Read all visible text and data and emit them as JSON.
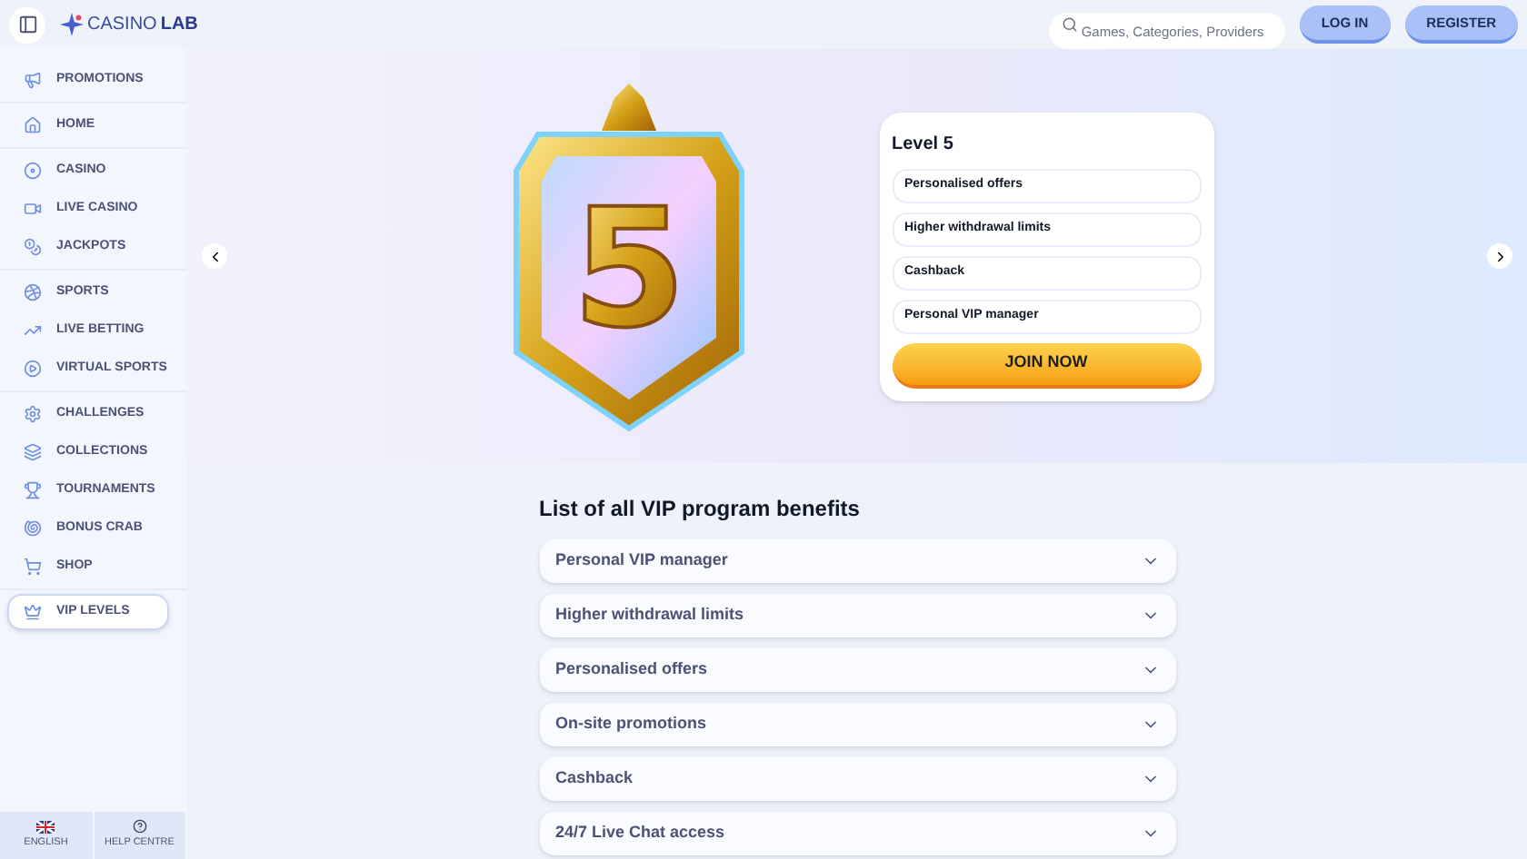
{
  "header": {
    "brand": {
      "light": "CASINO",
      "bold": "LAB"
    },
    "search": {
      "placeholder": "Games, Categories, Providers"
    },
    "buttons": [
      "LOG IN",
      "REGISTER"
    ]
  },
  "sidebar": {
    "groups": [
      [
        {
          "label": "PROMOTIONS",
          "selected": false
        }
      ],
      [
        {
          "label": "HOME",
          "selected": false
        }
      ],
      [
        {
          "label": "CASINO",
          "selected": false
        },
        {
          "label": "LIVE CASINO",
          "selected": false
        },
        {
          "label": "JACKPOTS",
          "selected": false
        }
      ],
      [
        {
          "label": "SPORTS",
          "selected": false
        },
        {
          "label": "LIVE BETTING",
          "selected": false
        },
        {
          "label": "VIRTUAL SPORTS",
          "selected": false
        }
      ],
      [
        {
          "label": "CHALLENGES",
          "selected": false
        },
        {
          "label": "COLLECTIONS",
          "selected": false
        },
        {
          "label": "TOURNAMENTS",
          "selected": false
        },
        {
          "label": "BONUS CRAB",
          "selected": false
        },
        {
          "label": "SHOP",
          "selected": false
        }
      ],
      [
        {
          "label": "VIP LEVELS",
          "selected": true
        }
      ]
    ],
    "footer": [
      "ENGLISH",
      "HELP CENTRE"
    ]
  },
  "hero": {
    "badge_numeral": "5",
    "card": {
      "title": "Level 5",
      "benefits": [
        "Personalised offers",
        "Higher withdrawal limits",
        "Cashback",
        "Personal VIP manager"
      ],
      "button": "JOIN NOW"
    }
  },
  "benefits": {
    "title": "List of all VIP program benefits",
    "items": [
      {
        "label": "Personal VIP manager",
        "expanded": false
      },
      {
        "label": "Higher withdrawal limits",
        "expanded": false
      },
      {
        "label": "Personalised offers",
        "expanded": false
      },
      {
        "label": "On-site promotions",
        "expanded": false
      },
      {
        "label": "Cashback",
        "expanded": false
      },
      {
        "label": "24/7 Live Chat access",
        "expanded": false
      }
    ]
  }
}
